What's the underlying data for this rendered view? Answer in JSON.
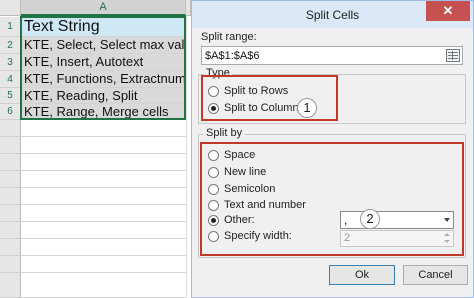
{
  "spreadsheet": {
    "column_header": "A",
    "rows": [
      {
        "num": "1",
        "text": "Text String"
      },
      {
        "num": "2",
        "text": "KTE, Select, Select max value"
      },
      {
        "num": "3",
        "text": "KTE, Insert, Autotext"
      },
      {
        "num": "4",
        "text": "KTE, Functions, Extractnumbers"
      },
      {
        "num": "5",
        "text": "KTE, Reading, Split"
      },
      {
        "num": "6",
        "text": "KTE, Range, Merge cells"
      }
    ],
    "accent_color": "#217346"
  },
  "dialog": {
    "title": "Split Cells",
    "close_label": "✕",
    "range_label": "Split range:",
    "range_value": "$A$1:$A$6",
    "range_icon": "range-select-icon",
    "type": {
      "legend": "Type",
      "options": [
        "Split to Rows",
        "Split to Columns"
      ],
      "selected": "Split to Columns",
      "badge": "1"
    },
    "split_by": {
      "legend": "Split by",
      "options": [
        "Space",
        "New line",
        "Semicolon",
        "Text and number",
        "Other:",
        "Specify width:"
      ],
      "selected": "Other:",
      "other_value": ",",
      "width_value": "2",
      "badge": "2"
    },
    "ok_label": "Ok",
    "cancel_label": "Cancel",
    "highlight_color": "#c0392b"
  }
}
